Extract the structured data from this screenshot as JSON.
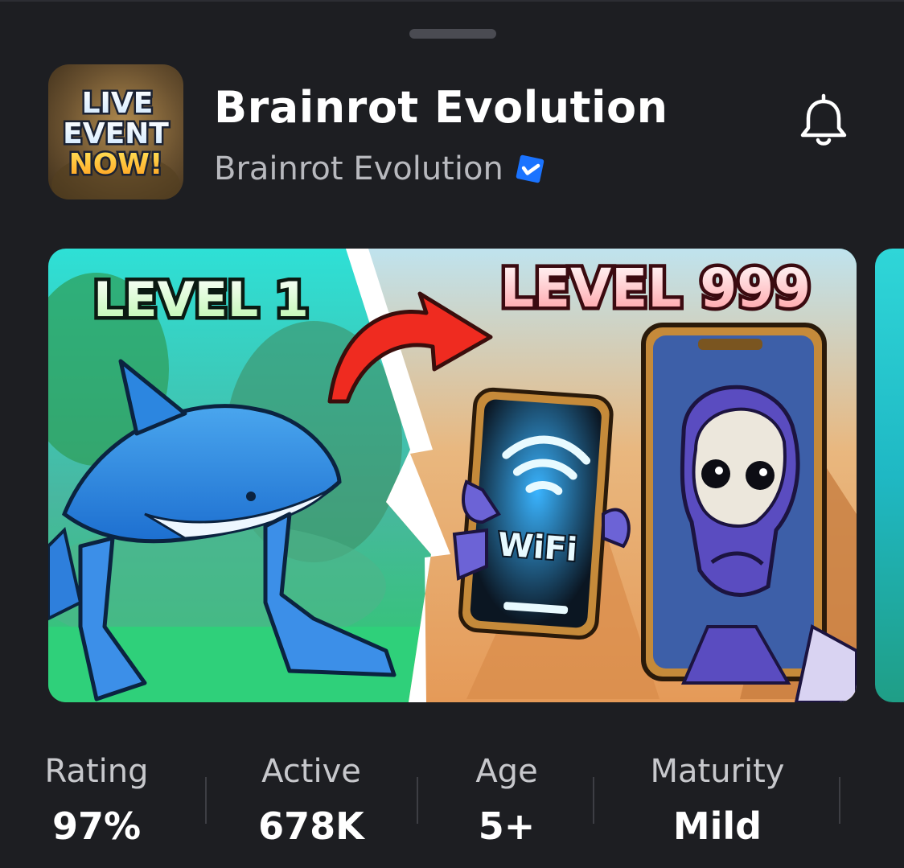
{
  "game": {
    "title": "Brainrot Evolution",
    "creator": "Brainrot Evolution",
    "creator_verified": true,
    "icon_text": [
      "LIVE",
      "EVENT",
      "NOW!"
    ]
  },
  "thumbnail": {
    "left_label": "LEVEL 1",
    "right_label": "LEVEL 999",
    "phone_text": "WiFi"
  },
  "stats": [
    {
      "label": "Rating",
      "value": "97%"
    },
    {
      "label": "Active",
      "value": "678K"
    },
    {
      "label": "Age",
      "value": "5+"
    },
    {
      "label": "Maturity",
      "value": "Mild"
    }
  ],
  "colors": {
    "background": "#1d1e22",
    "verified_badge": "#1a73ff",
    "label_gray": "#c7c8cc"
  },
  "icons": [
    "bell-icon",
    "verified-badge-icon"
  ]
}
